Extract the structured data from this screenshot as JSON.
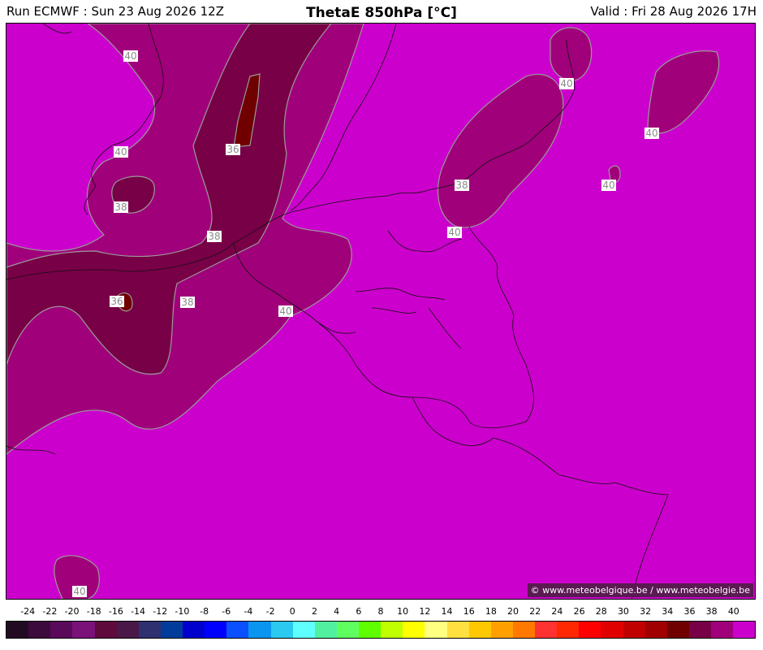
{
  "header": {
    "run": "Run ECMWF : Sun 23 Aug 2026 12Z",
    "title": "ThetaE 850hPa [°C]",
    "valid": "Valid : Fri 28 Aug 2026 17H"
  },
  "credit": "© www.meteobelgique.be / www.meteobelgie.be",
  "map": {
    "background_color": "#cc00cc",
    "contour_labels": [
      "40",
      "40",
      "40",
      "40",
      "40",
      "40",
      "40",
      "40",
      "38",
      "38",
      "38",
      "38",
      "36",
      "36"
    ]
  },
  "colorbar": {
    "ticks": [
      "-24",
      "-22",
      "-20",
      "-18",
      "-16",
      "-14",
      "-12",
      "-10",
      "-8",
      "-6",
      "-4",
      "-2",
      "0",
      "2",
      "4",
      "6",
      "8",
      "10",
      "12",
      "14",
      "16",
      "18",
      "20",
      "22",
      "24",
      "26",
      "28",
      "30",
      "32",
      "34",
      "36",
      "38",
      "40"
    ],
    "colors": [
      "#230a23",
      "#3d0a3d",
      "#5a0a5a",
      "#7a127a",
      "#5e0a3c",
      "#4a1848",
      "#2e3070",
      "#023c9a",
      "#0000cc",
      "#0000ff",
      "#0a50ff",
      "#0a96f0",
      "#2bc8f0",
      "#60ffff",
      "#50f0a0",
      "#60ff60",
      "#60ff00",
      "#c0ff00",
      "#ffff00",
      "#ffff80",
      "#ffe040",
      "#ffc800",
      "#ffa000",
      "#ff7800",
      "#ff3232",
      "#ff2800",
      "#ff0000",
      "#e00000",
      "#c00000",
      "#a00000",
      "#700000",
      "#780046",
      "#a0007a",
      "#cc00cc"
    ]
  }
}
